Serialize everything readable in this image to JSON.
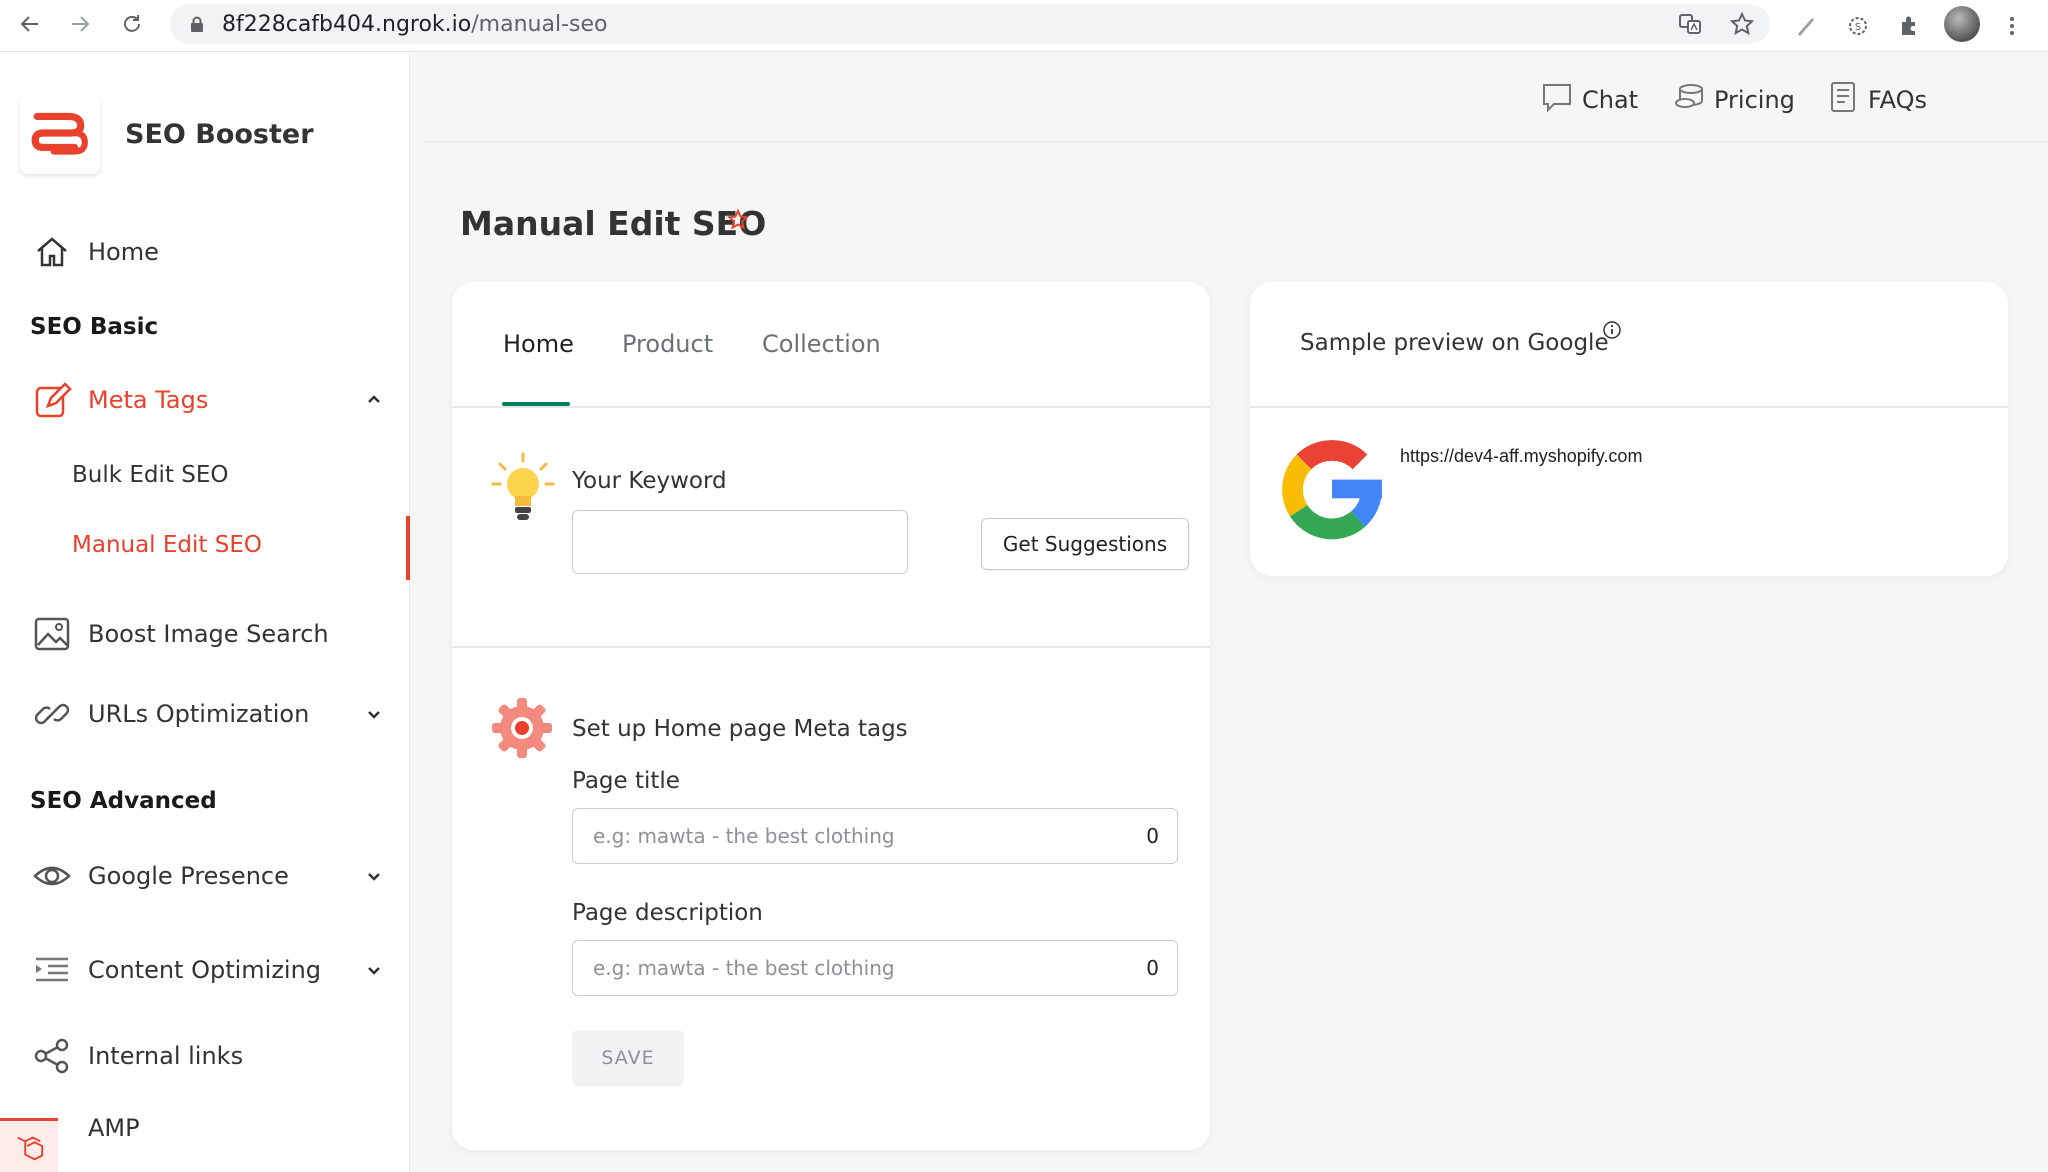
{
  "browser": {
    "url_host": "8f228cafb404.ngrok.io",
    "url_path": "/manual-seo"
  },
  "sidebar": {
    "brand_name": "SEO Booster",
    "home_label": "Home",
    "section_basic": "SEO Basic",
    "meta_tags_label": "Meta Tags",
    "bulk_edit_label": "Bulk Edit SEO",
    "manual_edit_label": "Manual Edit SEO",
    "boost_image_label": "Boost Image Search",
    "urls_label": "URLs Optimization",
    "section_advanced": "SEO Advanced",
    "google_presence_label": "Google Presence",
    "content_opt_label": "Content Optimizing",
    "internal_links_label": "Internal links",
    "amp_label": "AMP"
  },
  "header": {
    "chat_label": "Chat",
    "pricing_label": "Pricing",
    "faqs_label": "FAQs"
  },
  "page": {
    "title": "Manual Edit SEO"
  },
  "tabs": [
    {
      "label": "Home",
      "active": true
    },
    {
      "label": "Product",
      "active": false
    },
    {
      "label": "Collection",
      "active": false
    }
  ],
  "keyword": {
    "label": "Your Keyword",
    "value": "",
    "suggest_button": "Get Suggestions"
  },
  "meta": {
    "section_title": "Set up Home page Meta tags",
    "page_title_label": "Page title",
    "page_title_placeholder": "e.g: mawta - the best clothing",
    "page_title_count": "0",
    "page_desc_label": "Page description",
    "page_desc_placeholder": "e.g: mawta - the best clothing",
    "page_desc_count": "0",
    "save_label": "SAVE"
  },
  "preview": {
    "title": "Sample preview on Google",
    "url": "https://dev4-aff.myshopify.com"
  },
  "colors": {
    "accent": "#e8412c",
    "tab_indicator": "#008060"
  }
}
